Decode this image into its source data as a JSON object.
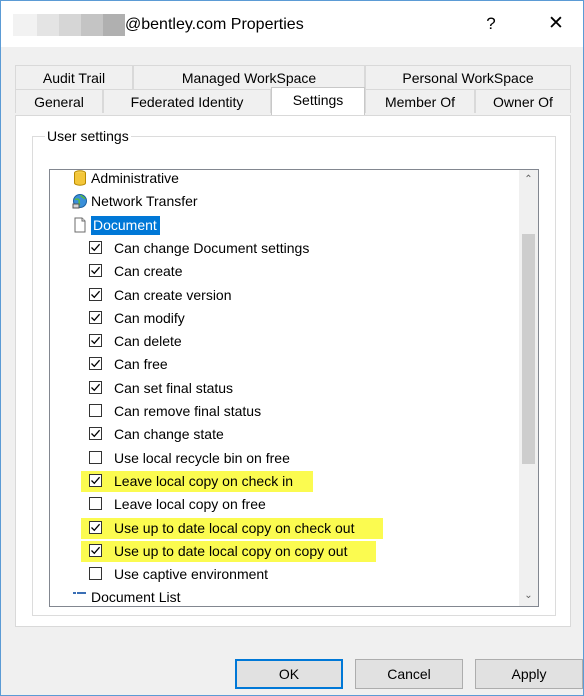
{
  "window": {
    "title": "@bentley.com Properties",
    "help_label": "?",
    "close_label": "✕",
    "redaction_colors": [
      "#f2f2f2",
      "#e4e4e4",
      "#d6d6d6",
      "#c4c4c4",
      "#b0b0b0"
    ]
  },
  "tabs": {
    "row1": [
      "Audit Trail",
      "Managed WorkSpace",
      "Personal WorkSpace"
    ],
    "row2": [
      "General",
      "Federated Identity",
      "Settings",
      "Member Of",
      "Owner Of"
    ],
    "active": "Settings"
  },
  "group": {
    "label": "User settings"
  },
  "tree": {
    "items": [
      {
        "label": "Administrative",
        "icon": "database-icon"
      },
      {
        "label": "Network Transfer",
        "icon": "globe-network-icon"
      },
      {
        "label": "Document",
        "icon": "document-icon",
        "selected": true
      },
      {
        "label": "Can change Document settings",
        "checked": true
      },
      {
        "label": "Can create",
        "checked": true
      },
      {
        "label": "Can create version",
        "checked": true
      },
      {
        "label": "Can modify",
        "checked": true
      },
      {
        "label": "Can delete",
        "checked": true
      },
      {
        "label": "Can free",
        "checked": true
      },
      {
        "label": "Can set final status",
        "checked": true
      },
      {
        "label": "Can remove final status",
        "checked": false
      },
      {
        "label": "Can change state",
        "checked": true
      },
      {
        "label": "Use local recycle bin on free",
        "checked": false
      },
      {
        "label": "Leave local copy on check in",
        "checked": true,
        "highlighted": true
      },
      {
        "label": "Leave local copy on free",
        "checked": false
      },
      {
        "label": "Use up to date local copy on check out",
        "checked": true,
        "highlighted": true
      },
      {
        "label": "Use up to date local copy on copy out",
        "checked": true,
        "highlighted": true
      },
      {
        "label": "Use captive environment",
        "checked": false
      },
      {
        "label": "Document List",
        "icon": "list-icon"
      }
    ],
    "highlight_color": "#fbfb50",
    "selection_color": "#0078d7"
  },
  "buttons": {
    "ok": "OK",
    "cancel": "Cancel",
    "apply": "Apply"
  }
}
